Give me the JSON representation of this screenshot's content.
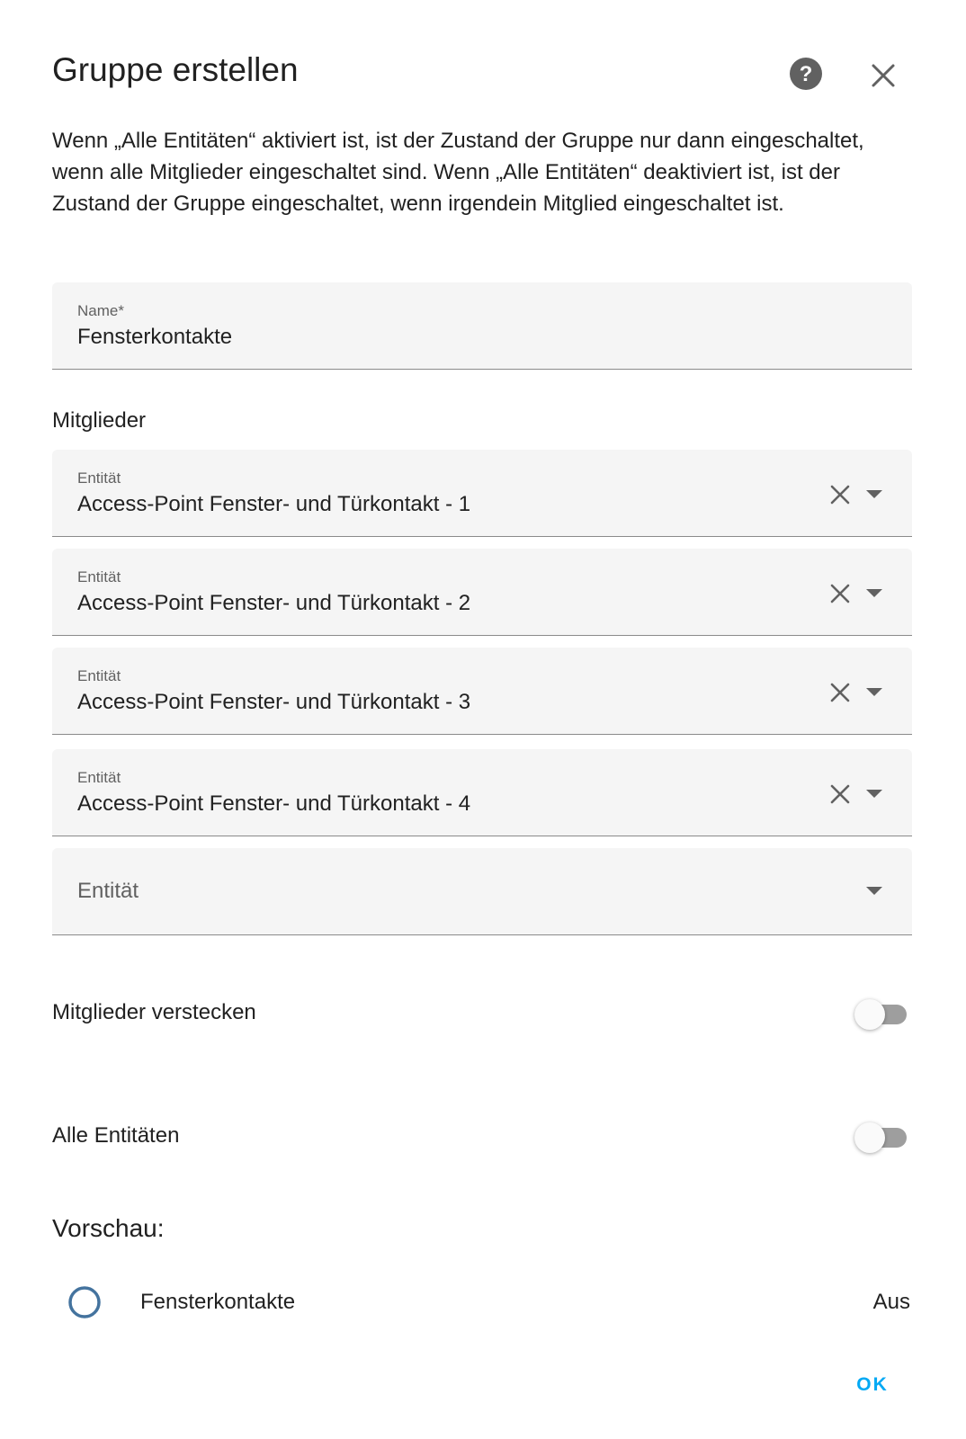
{
  "dialog": {
    "title": "Gruppe erstellen",
    "description": "Wenn „Alle Entitäten“ aktiviert ist, ist der Zustand der Gruppe nur dann eingeschaltet, wenn alle Mitglieder eingeschaltet sind. Wenn „Alle Entitäten“ deaktiviert ist, ist der Zustand der Gruppe eingeschaltet, wenn irgendein Mitglied eingeschaltet ist."
  },
  "name_field": {
    "label": "Name*",
    "value": "Fensterkontakte"
  },
  "members": {
    "label": "Mitglieder",
    "entries": [
      {
        "label": "Entität",
        "value": "Access-Point Fenster- und Türkontakt - 1"
      },
      {
        "label": "Entität",
        "value": "Access-Point Fenster- und Türkontakt - 2"
      },
      {
        "label": "Entität",
        "value": "Access-Point Fenster- und Türkontakt - 3"
      },
      {
        "label": "Entität",
        "value": "Access-Point Fenster- und Türkontakt - 4"
      }
    ],
    "empty_placeholder": "Entität"
  },
  "toggles": {
    "hide_members": {
      "label": "Mitglieder verstecken",
      "checked": false
    },
    "all_entities": {
      "label": "Alle Entitäten",
      "checked": false
    }
  },
  "preview": {
    "title": "Vorschau:",
    "entity_name": "Fensterkontakte",
    "state": "Aus"
  },
  "actions": {
    "ok_label": "OK"
  },
  "colors": {
    "accent": "#03a9f4",
    "preview_icon": "#44739e",
    "field_bg": "#f5f5f5",
    "switch_track_off": "#9e9e9e"
  }
}
